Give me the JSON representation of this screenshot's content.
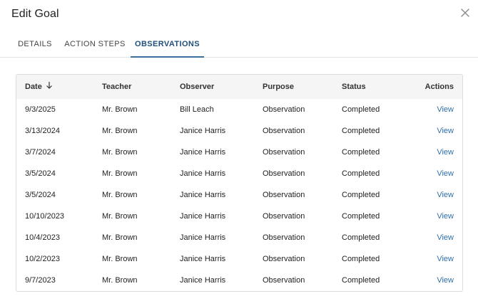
{
  "dialog": {
    "title": "Edit Goal",
    "close_icon": "close-icon"
  },
  "tabs": [
    {
      "label": "DETAILS",
      "active": false
    },
    {
      "label": "ACTION STEPS",
      "active": false
    },
    {
      "label": "OBSERVATIONS",
      "active": true
    }
  ],
  "table": {
    "columns": {
      "date": "Date",
      "teacher": "Teacher",
      "observer": "Observer",
      "purpose": "Purpose",
      "status": "Status",
      "actions": "Actions"
    },
    "sort_icon": "arrow-down-icon",
    "rows": [
      {
        "date": "9/3/2025",
        "teacher": "Mr. Brown",
        "observer": "Bill Leach",
        "purpose": "Observation",
        "status": "Completed",
        "action": "View"
      },
      {
        "date": "3/13/2024",
        "teacher": "Mr. Brown",
        "observer": "Janice Harris",
        "purpose": "Observation",
        "status": "Completed",
        "action": "View"
      },
      {
        "date": "3/7/2024",
        "teacher": "Mr. Brown",
        "observer": "Janice Harris",
        "purpose": "Observation",
        "status": "Completed",
        "action": "View"
      },
      {
        "date": "3/5/2024",
        "teacher": "Mr. Brown",
        "observer": "Janice Harris",
        "purpose": "Observation",
        "status": "Completed",
        "action": "View"
      },
      {
        "date": "3/5/2024",
        "teacher": "Mr. Brown",
        "observer": "Janice Harris",
        "purpose": "Observation",
        "status": "Completed",
        "action": "View"
      },
      {
        "date": "10/10/2023",
        "teacher": "Mr. Brown",
        "observer": "Janice Harris",
        "purpose": "Observation",
        "status": "Completed",
        "action": "View"
      },
      {
        "date": "10/4/2023",
        "teacher": "Mr. Brown",
        "observer": "Janice Harris",
        "purpose": "Observation",
        "status": "Completed",
        "action": "View"
      },
      {
        "date": "10/2/2023",
        "teacher": "Mr. Brown",
        "observer": "Janice Harris",
        "purpose": "Observation",
        "status": "Completed",
        "action": "View"
      },
      {
        "date": "9/7/2023",
        "teacher": "Mr. Brown",
        "observer": "Janice Harris",
        "purpose": "Observation",
        "status": "Completed",
        "action": "View"
      }
    ]
  },
  "colors": {
    "accent": "#1f4f7a",
    "link": "#2f6fa8",
    "header_bg": "#f5f5f5"
  }
}
